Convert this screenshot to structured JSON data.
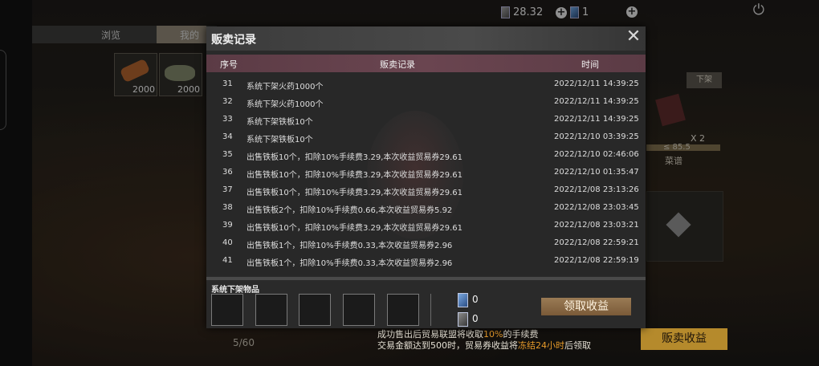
{
  "topbar": {
    "currency_value": "28.32",
    "ticket_count": "1"
  },
  "background": {
    "tabs": [
      "浏览",
      "我的"
    ],
    "inventory": [
      {
        "icon": "wood-log-icon",
        "count": "2000"
      },
      {
        "icon": "iron-plate-icon",
        "count": "2000"
      }
    ],
    "page_count": "5/60",
    "unlist_label": "下架",
    "item_qty": "X 2",
    "item_stat": "≤ 85.5",
    "item_name": "菜谱",
    "sell_profit_label": "贩卖收益",
    "hint_line1_pre": "成功售出后贸易联盟将收取",
    "hint_line1_pct": "10%",
    "hint_line1_post": "的手续费",
    "hint_line2_pre": "交易金额达到500时，贸易券收益将",
    "hint_line2_hl": "冻结24小时",
    "hint_line2_post": "后领取"
  },
  "modal": {
    "title": "贩卖记录",
    "columns": {
      "num": "序号",
      "record": "贩卖记录",
      "time": "时间"
    },
    "rows": [
      {
        "num": "31",
        "record": "系统下架火药1000个",
        "time": "2022/12/11 14:39:25"
      },
      {
        "num": "32",
        "record": "系统下架火药1000个",
        "time": "2022/12/11 14:39:25"
      },
      {
        "num": "33",
        "record": "系统下架铁板10个",
        "time": "2022/12/11 14:39:25"
      },
      {
        "num": "34",
        "record": "系统下架铁板10个",
        "time": "2022/12/10 03:39:25"
      },
      {
        "num": "35",
        "record": "出售铁板10个，扣除10%手续费3.29,本次收益贸易券29.61",
        "time": "2022/12/10 02:46:06"
      },
      {
        "num": "36",
        "record": "出售铁板10个，扣除10%手续费3.29,本次收益贸易券29.61",
        "time": "2022/12/10 01:35:47"
      },
      {
        "num": "37",
        "record": "出售铁板10个，扣除10%手续费3.29,本次收益贸易券29.61",
        "time": "2022/12/08 23:13:26"
      },
      {
        "num": "38",
        "record": "出售铁板2个，扣除10%手续费0.66,本次收益贸易券5.92",
        "time": "2022/12/08 23:03:45"
      },
      {
        "num": "39",
        "record": "出售铁板10个，扣除10%手续费3.29,本次收益贸易券29.61",
        "time": "2022/12/08 23:03:21"
      },
      {
        "num": "40",
        "record": "出售铁板1个，扣除10%手续费0.33,本次收益贸易券2.96",
        "time": "2022/12/08 22:59:21"
      },
      {
        "num": "41",
        "record": "出售铁板1个，扣除10%手续费0.33,本次收益贸易券2.96",
        "time": "2022/12/08 22:59:19"
      }
    ],
    "items_label": "系统下架物品",
    "ticket_a": "0",
    "ticket_b": "0",
    "collect_label": "领取收益"
  }
}
